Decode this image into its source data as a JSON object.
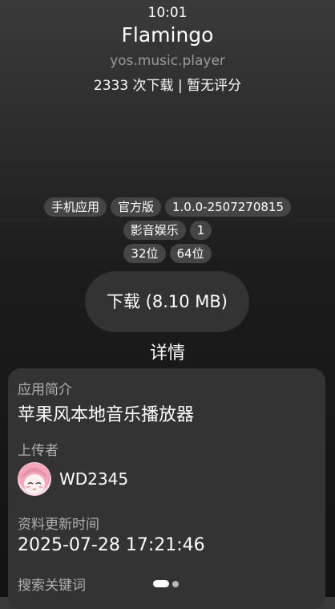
{
  "status_bar": {
    "time": "10:01"
  },
  "app": {
    "name": "Flamingo",
    "package": "yos.music.player",
    "stats": "2333 次下载 | 暂无评分"
  },
  "tags": {
    "row1": [
      "手机应用",
      "官方版",
      "1.0.0-2507270815"
    ],
    "row2": [
      "影音娱乐",
      "1"
    ],
    "row3": [
      "32位",
      "64位"
    ]
  },
  "download_button": {
    "label": "下载 (8.10 MB)"
  },
  "details": {
    "title": "详情",
    "intro_label": "应用简介",
    "intro_text": "苹果风本地音乐播放器",
    "uploader_label": "上传者",
    "uploader_name": "WD2345",
    "updated_label": "资料更新时间",
    "updated_value": "2025-07-28 17:21:46",
    "keywords_label": "搜索关键词"
  },
  "pager": {
    "pages": 2,
    "active": 1
  },
  "colors": {
    "tag_bg": "#454545",
    "button_bg": "#333333",
    "card_bg": "#333333",
    "avatar_hair": "#f2a7be"
  }
}
